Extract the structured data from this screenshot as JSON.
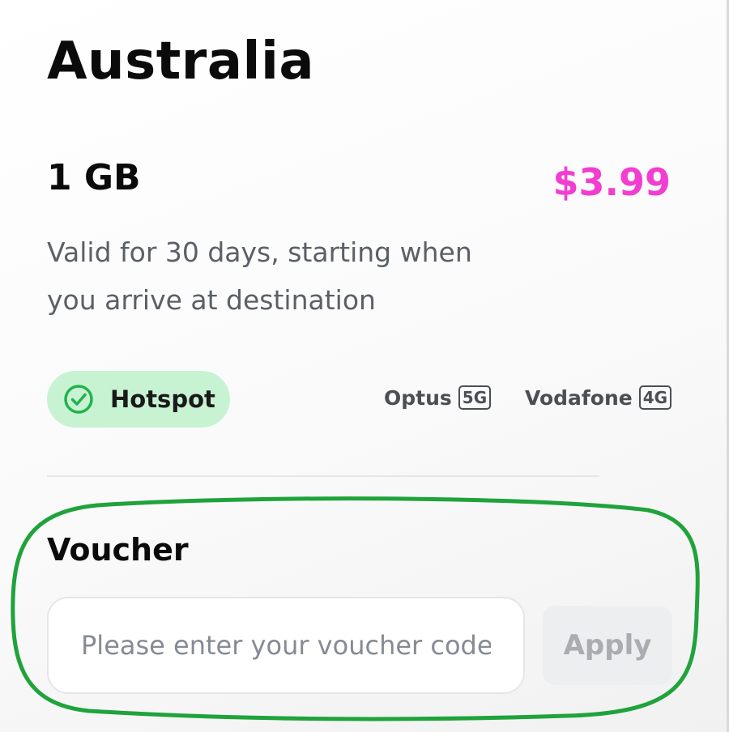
{
  "country": {
    "name": "Australia"
  },
  "plan": {
    "data_amount": "1 GB",
    "price": "$3.99",
    "description": "Valid for 30 days, starting when you arrive at destination",
    "price_color": "#f23ed0"
  },
  "features": {
    "hotspot_label": "Hotspot",
    "hotspot_icon": "check-circle-icon",
    "hotspot_bg": "#c8f3d3"
  },
  "networks": [
    {
      "carrier": "Optus",
      "generation": "5G"
    },
    {
      "carrier": "Vodafone",
      "generation": "4G"
    }
  ],
  "voucher": {
    "label": "Voucher",
    "placeholder": "Please enter your voucher code",
    "value": "",
    "apply_label": "Apply"
  },
  "annotation": {
    "highlight_color": "#1fa33a"
  }
}
